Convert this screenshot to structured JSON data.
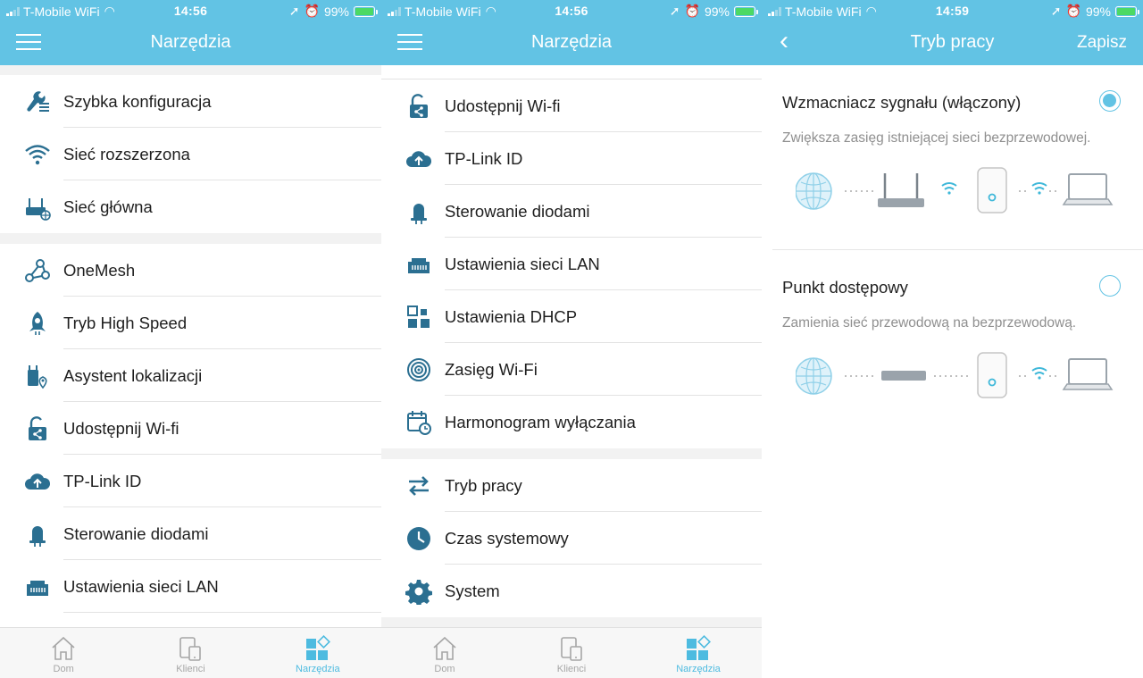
{
  "status_bar": [
    {
      "carrier": "T-Mobile WiFi",
      "time": "14:56",
      "battery": "99%"
    },
    {
      "carrier": "T-Mobile WiFi",
      "time": "14:56",
      "battery": "99%"
    },
    {
      "carrier": "T-Mobile WiFi",
      "time": "14:59",
      "battery": "99%"
    }
  ],
  "panel1": {
    "title": "Narzędzia",
    "items": [
      {
        "label": "Szybka konfiguracja",
        "icon": "wrench-icon"
      },
      {
        "label": "Sieć rozszerzona",
        "icon": "wifi-icon"
      },
      {
        "label": "Sieć główna",
        "icon": "router-globe-icon"
      },
      {
        "label": "OneMesh",
        "icon": "mesh-icon"
      },
      {
        "label": "Tryb High Speed",
        "icon": "rocket-icon"
      },
      {
        "label": "Asystent lokalizacji",
        "icon": "location-assistant-icon"
      },
      {
        "label": "Udostępnij Wi-fi",
        "icon": "share-lock-icon"
      },
      {
        "label": "TP-Link ID",
        "icon": "cloud-upload-icon"
      },
      {
        "label": "Sterowanie diodami",
        "icon": "led-bell-icon"
      },
      {
        "label": "Ustawienia sieci LAN",
        "icon": "lan-port-icon"
      }
    ]
  },
  "panel2": {
    "title": "Narzędzia",
    "items": [
      {
        "label": "Udostępnij Wi-fi",
        "icon": "share-lock-icon"
      },
      {
        "label": "TP-Link ID",
        "icon": "cloud-upload-icon"
      },
      {
        "label": "Sterowanie diodami",
        "icon": "led-bell-icon"
      },
      {
        "label": "Ustawienia sieci LAN",
        "icon": "lan-port-icon"
      },
      {
        "label": "Ustawienia DHCP",
        "icon": "dhcp-icon"
      },
      {
        "label": "Zasięg Wi-Fi",
        "icon": "coverage-icon"
      },
      {
        "label": "Harmonogram wyłączania",
        "icon": "calendar-clock-icon"
      },
      {
        "label": "Tryb pracy",
        "icon": "swap-arrows-icon"
      },
      {
        "label": "Czas systemowy",
        "icon": "clock-icon"
      },
      {
        "label": "System",
        "icon": "gear-icon"
      }
    ]
  },
  "tabs": [
    {
      "label": "Dom",
      "icon": "home-icon"
    },
    {
      "label": "Klienci",
      "icon": "devices-icon"
    },
    {
      "label": "Narzędzia",
      "icon": "tools-grid-icon"
    }
  ],
  "panel3": {
    "title": "Tryb pracy",
    "save_label": "Zapisz",
    "modes": [
      {
        "title": "Wzmacniacz sygnału (włączony)",
        "desc": "Zwiększa zasięg istniejącej sieci bezprzewodowej.",
        "selected": true
      },
      {
        "title": "Punkt dostępowy",
        "desc": "Zamienia sieć przewodową na bezprzewodową.",
        "selected": false
      }
    ]
  },
  "colors": {
    "accent": "#62c3e4",
    "icon": "#2b6f91",
    "divider": "#e3e3e3"
  }
}
